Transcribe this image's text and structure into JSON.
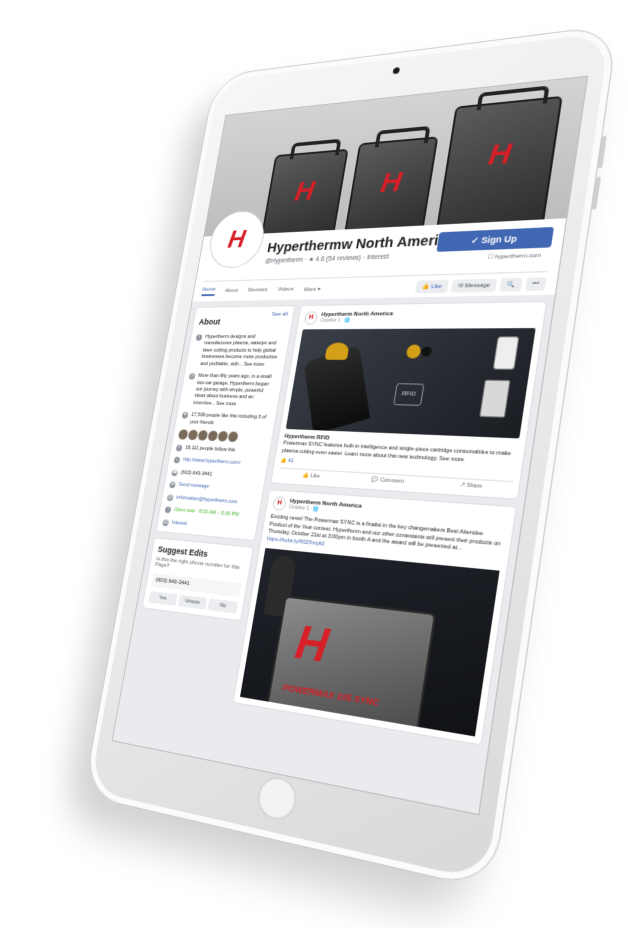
{
  "page": {
    "name": "Hyperthermw North America",
    "meta": "@Hypertherm · ★ 4.6 (54 reviews) · Interest",
    "signup_label": "✓ Sign Up",
    "website": "☐ hypertherm.com"
  },
  "tabs": [
    {
      "label": "Home"
    },
    {
      "label": "About"
    },
    {
      "label": "Reviews"
    },
    {
      "label": "Videos"
    },
    {
      "label": "More ▾"
    }
  ],
  "actions": {
    "like": "👍 Like",
    "message": "✉ Message",
    "search": "🔍",
    "more": "•••"
  },
  "about": {
    "title": "About",
    "see_all": "See all",
    "rows": [
      {
        "icon": "info-icon",
        "text": "Hypertherm designs and manufactures plasma, waterjet and laser cutting products to help global businesses become more productive and profitable, with... See more"
      },
      {
        "icon": "history-icon",
        "text": "More than fifty years ago, in a small two-car garage, Hypertherm began our journey with simple, powerful ideas about business and an inventive... See more"
      },
      {
        "icon": "like-icon",
        "text": "17,539 people like this including 3 of your friends"
      },
      {
        "icon": "follow-icon",
        "text": "18,111 people follow this"
      },
      {
        "icon": "web-icon",
        "text": "http://www.hypertherm.com/"
      },
      {
        "icon": "phone-icon",
        "text": "(603) 643-3441"
      },
      {
        "icon": "message-icon",
        "text": "Send message"
      },
      {
        "icon": "email-icon",
        "text": "information@hypertherm.com"
      },
      {
        "icon": "clock-icon",
        "text": "Open now · 8:00 AM – 5:00 PM"
      },
      {
        "icon": "category-icon",
        "text": "Interest"
      }
    ]
  },
  "support": {
    "title": "Suggest Edits",
    "question": "Is this the right phone number for this Page?",
    "phone": "(603) 643-3441",
    "buttons": [
      "Yes",
      "Unsure",
      "No"
    ]
  },
  "post1": {
    "author": "Hypertherm North America",
    "time": "October 1 · 🌐",
    "rfid_label": "RFID",
    "caption_title": "Hypertherm RFID",
    "caption": "Powermax SYNC features built-in intelligence and single-piece cartridge consumables to make plasma cutting even easier. Learn more about this new technology. See more",
    "reactions": "👍 41",
    "like": "👍 Like",
    "comment": "💬 Comment",
    "share": "↗ Share"
  },
  "post2": {
    "author": "Hypertherm North America",
    "time": "October 1 · 🌐",
    "text": "Exciting news! The Powermax SYNC is a finalist in the key changemakers Best Attendee Product of the Year contest. Hypertherm and our other contestants will present their products on Thursday, October 21st at 3:00pm in booth A and the award will be presented at... ",
    "link": "https://hubs.ly/H0ZXmyk0",
    "brand": "POWERMAX 105 SYNC"
  }
}
